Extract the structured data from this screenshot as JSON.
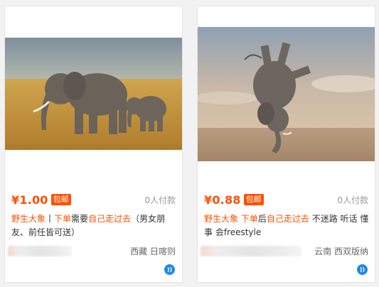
{
  "products": [
    {
      "image_alt": "elephant-mother-and-calf",
      "price": "¥1.00",
      "badge": "包邮",
      "sold": "0人付款",
      "title_parts": [
        "野生大象",
        "丨",
        "下单",
        "需要",
        "自己走过去",
        "（男女朋友、前任皆可送）"
      ],
      "location": "西藏 日喀则",
      "chat_icon": "wangwang-icon"
    },
    {
      "image_alt": "handstand-elephant",
      "price": "¥0.88",
      "badge": "包邮",
      "sold": "0人付款",
      "title_parts": [
        "野生大象",
        " ",
        "下单",
        "后",
        "自己走过去",
        " 不迷路 听话 懂事 会freestyle"
      ],
      "location": "云南 西双版纳",
      "chat_icon": "wangwang-icon"
    }
  ],
  "colors": {
    "accent": "#ff5000",
    "chat": "#1e88e5"
  }
}
